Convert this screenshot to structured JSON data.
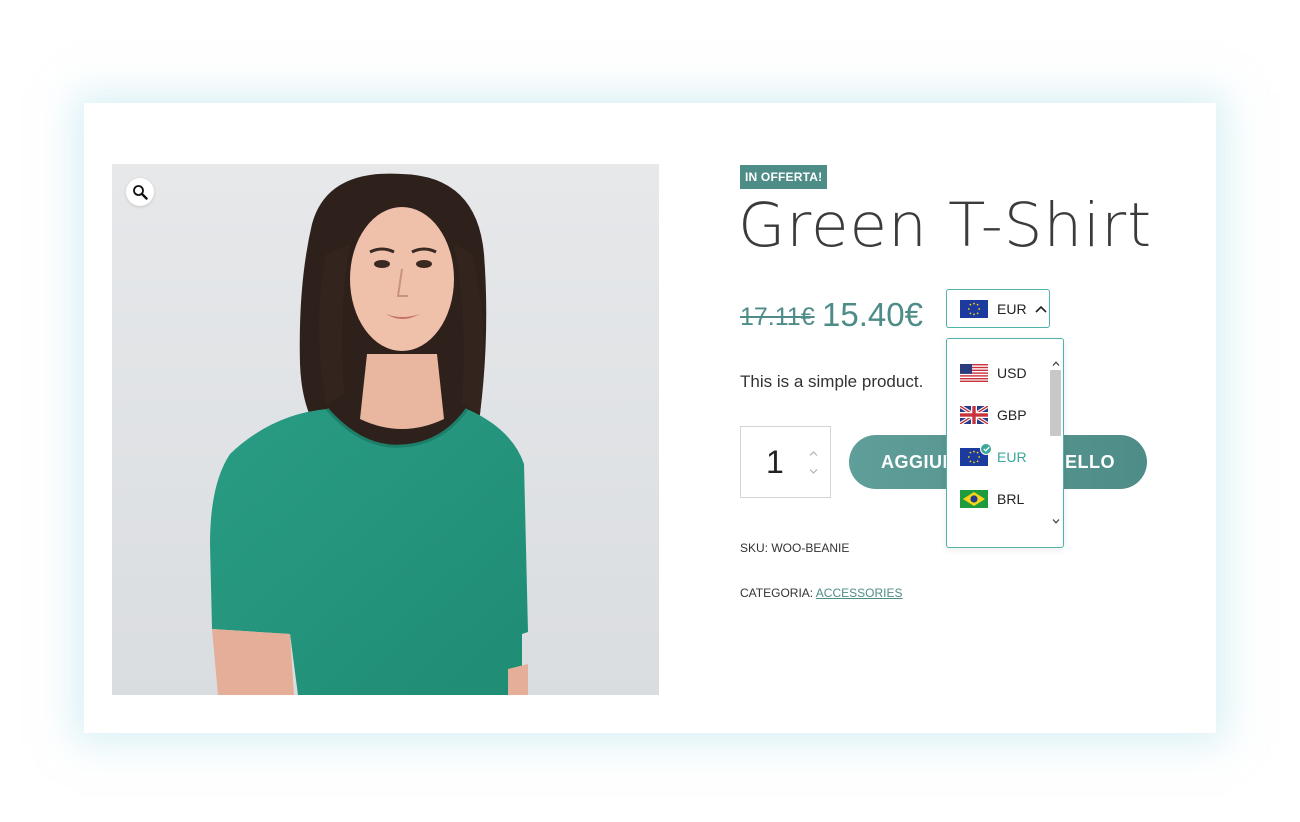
{
  "product": {
    "badge": "IN OFFERTA!",
    "title": "Green T-Shirt",
    "price_old": "17.11€",
    "price_new": "15.40€",
    "description": "This is a simple product.",
    "quantity": "1",
    "add_to_cart_label": "AGGIUNGI AL CARRELLO",
    "sku_label": "SKU:",
    "sku_value": "WOO-BEANIE",
    "category_label": "CATEGORIA:",
    "category_value": "ACCESSORIES"
  },
  "currency_switcher": {
    "selected": {
      "code": "EUR",
      "flag": "eu-flag-icon"
    },
    "expanded": true,
    "options": [
      {
        "code": "USD",
        "flag": "us-flag-icon"
      },
      {
        "code": "GBP",
        "flag": "uk-flag-icon"
      },
      {
        "code": "EUR",
        "flag": "eu-flag-icon",
        "selected": true
      },
      {
        "code": "BRL",
        "flag": "br-flag-icon"
      }
    ]
  },
  "colors": {
    "accent": "#4e8c88",
    "selected_currency": "#3aa79b",
    "dropdown_border": "#4fb2a8"
  }
}
